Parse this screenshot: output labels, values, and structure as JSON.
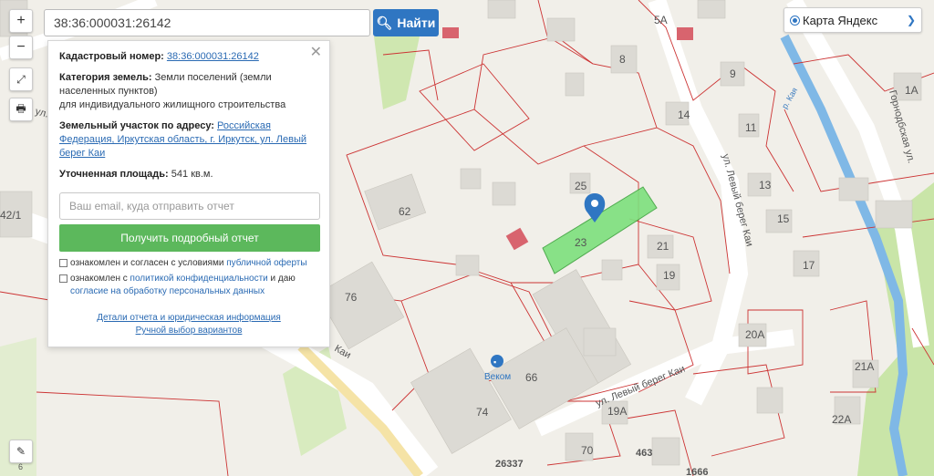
{
  "search": {
    "value": "38:36:000031:26142",
    "button_label": "Найти"
  },
  "zoom": {
    "in": "+",
    "out": "−"
  },
  "layer_select": {
    "selected": "Карта Яндекс"
  },
  "panel": {
    "cadastral_label": "Кадастровый номер:",
    "cadastral_value": "38:36:000031:26142",
    "category_label": "Категория земель:",
    "category_value": "Земли поселений (земли населенных пунктов)",
    "category_use": "для индивидуального жилищного строительства",
    "address_label": "Земельный участок по адресу:",
    "address_value": "Российская Федерация, Иркутская область, г. Иркутск, ул. Левый берег Каи",
    "area_label": "Уточненная площадь:",
    "area_value": "541 кв.м.",
    "email_placeholder": "Ваш email, куда отправить отчет",
    "report_button": "Получить подробный отчет",
    "consent1_prefix": "ознакомлен и согласен с условиями ",
    "consent1_link": "публичной оферты",
    "consent2_prefix": "ознакомлен с ",
    "consent2_link": "политикой конфиденциальности",
    "consent2_mid": " и даю",
    "consent2_link2": "согласие на обработку персональных данных",
    "details_link": "Детали отчета и юридическая информация",
    "manual_link": "Ручной выбор вариантов"
  },
  "map_labels": {
    "street1": "ул. Левый берег Каи",
    "street2": "ул. Левый берег Каи",
    "street3": "Горнодбская ул.",
    "street_left": "ул. Лев",
    "street_kai": "Каи",
    "river": "р. Кая",
    "house_numbers": [
      "5А",
      "8",
      "9",
      "11",
      "1А",
      "14",
      "13",
      "15",
      "17",
      "21",
      "19",
      "20А",
      "21А",
      "22А",
      "62",
      "25",
      "23",
      "66",
      "74",
      "70",
      "19А",
      "76",
      "42/1",
      "6"
    ],
    "parcel_numbers": [
      "26337",
      "463",
      "1666"
    ],
    "poi": "Веком"
  }
}
